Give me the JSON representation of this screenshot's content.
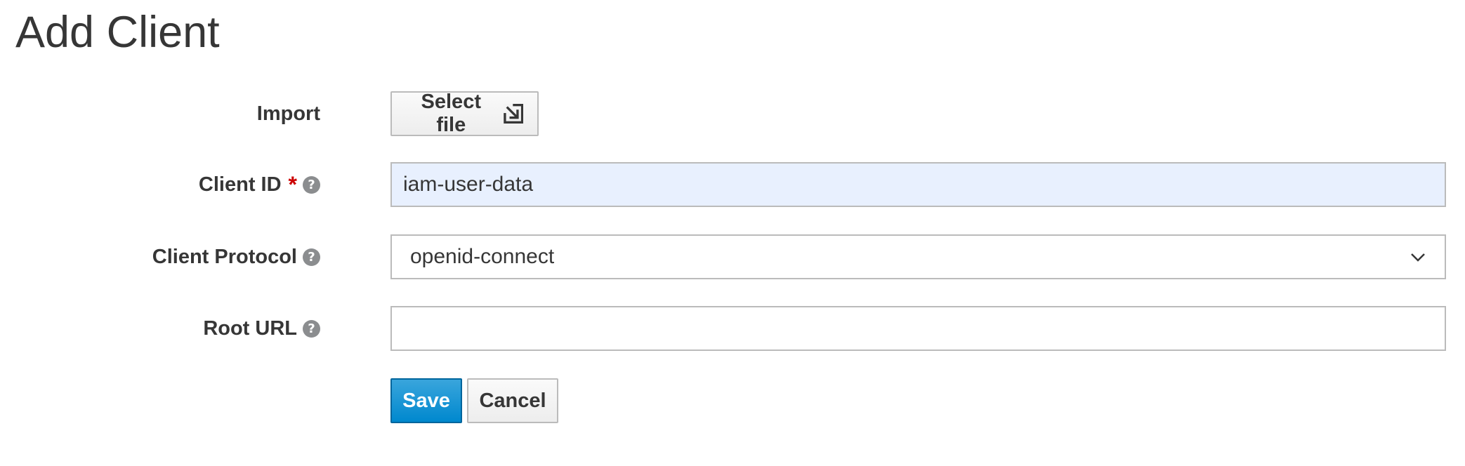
{
  "page": {
    "title": "Add Client"
  },
  "form": {
    "import": {
      "label": "Import",
      "button_label": "Select file",
      "button_icon": "import-icon"
    },
    "client_id": {
      "label": "Client ID",
      "required_marker": "*",
      "help_icon": "?",
      "value": "iam-user-data"
    },
    "client_protocol": {
      "label": "Client Protocol",
      "help_icon": "?",
      "selected": "openid-connect"
    },
    "root_url": {
      "label": "Root URL",
      "help_icon": "?",
      "value": ""
    }
  },
  "actions": {
    "save_label": "Save",
    "cancel_label": "Cancel"
  },
  "colors": {
    "primary": "#0088ce",
    "required": "#cc0000",
    "autofill_bg": "#e8f0fe"
  }
}
